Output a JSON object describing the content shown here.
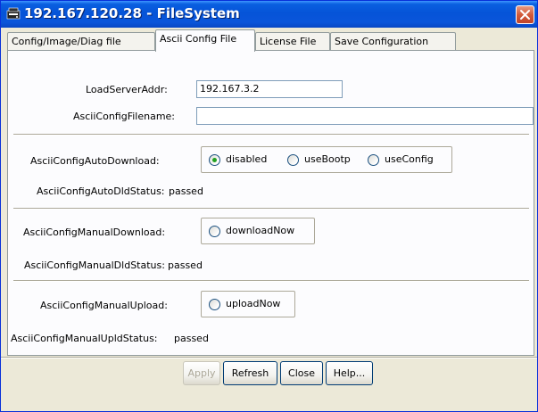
{
  "window": {
    "title": "192.167.120.28 - FileSystem"
  },
  "tabs": [
    {
      "label": "Config/Image/Diag file",
      "active": false
    },
    {
      "label": "Ascii Config File",
      "active": true
    },
    {
      "label": "License File",
      "active": false
    },
    {
      "label": "Save Configuration",
      "active": false
    }
  ],
  "form": {
    "load_server_label": "LoadServerAddr:",
    "load_server_value": "192.167.3.2",
    "ascii_filename_label": "AsciiConfigFilename:",
    "ascii_filename_value": "",
    "auto_download_label": "AsciiConfigAutoDownload:",
    "auto_download_options": [
      "disabled",
      "useBootp",
      "useConfig"
    ],
    "auto_download_selected": "disabled",
    "auto_dld_status_label": "AsciiConfigAutoDldStatus:",
    "auto_dld_status_value": "passed",
    "manual_download_label": "AsciiConfigManualDownload:",
    "manual_download_option": "downloadNow",
    "manual_dld_status_label": "AsciiConfigManualDldStatus:",
    "manual_dld_status_value": "passed",
    "manual_upload_label": "AsciiConfigManualUpload:",
    "manual_upload_option": "uploadNow",
    "manual_upld_status_label": "AsciiConfigManualUpldStatus:",
    "manual_upld_status_value": "passed"
  },
  "buttons": {
    "apply": "Apply",
    "refresh": "Refresh",
    "close": "Close",
    "help": "Help..."
  },
  "icons": {
    "title_icon": "filesystem-icon",
    "close_icon": "close-x-icon"
  }
}
